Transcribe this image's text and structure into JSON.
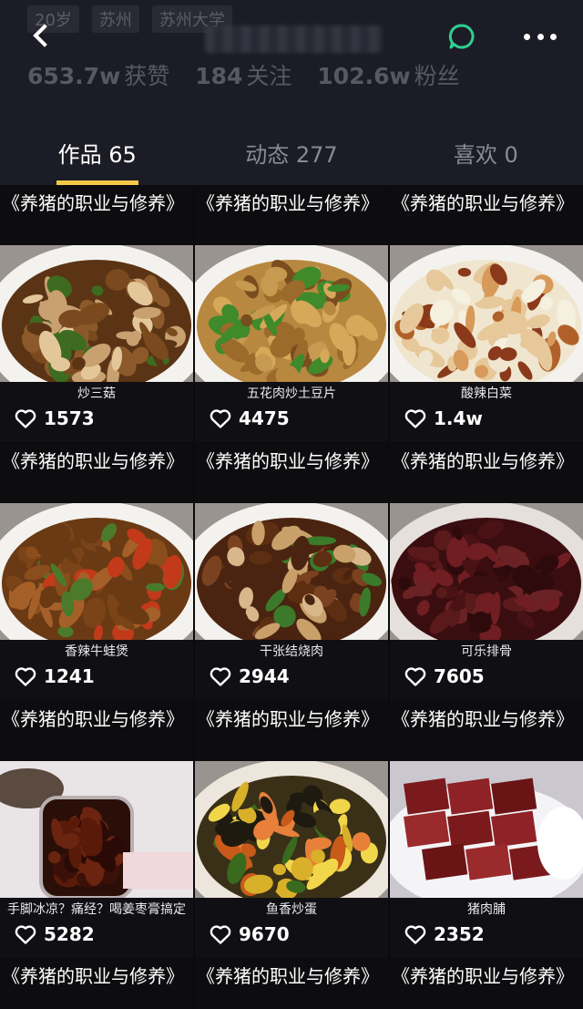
{
  "header": {
    "faded_info": [
      "20岁",
      "苏州",
      "苏州大学"
    ],
    "stats": [
      {
        "value": "653.7w",
        "label": "获赞"
      },
      {
        "value": "184",
        "label": "关注"
      },
      {
        "value": "102.6w",
        "label": "粉丝"
      }
    ]
  },
  "tabs": [
    {
      "label": "作品 65"
    },
    {
      "label": "动态 277"
    },
    {
      "label": "喜欢 0"
    }
  ],
  "accent_color": "#f6c947",
  "videos": [
    {
      "title": "《养猪的职业与修养》",
      "caption": "炒三菇",
      "likes": "1573",
      "dish": "mushroom"
    },
    {
      "title": "《养猪的职业与修养》",
      "caption": "五花肉炒土豆片",
      "likes": "4475",
      "dish": "potato"
    },
    {
      "title": "《养猪的职业与修养》",
      "caption": "酸辣白菜",
      "likes": "1.4w",
      "dish": "cabbage"
    },
    {
      "title": "《养猪的职业与修养》",
      "caption": "香辣牛蛙煲",
      "likes": "1241",
      "dish": "frog"
    },
    {
      "title": "《养猪的职业与修养》",
      "caption": "干张结烧肉",
      "likes": "2944",
      "dish": "pork"
    },
    {
      "title": "《养猪的职业与修养》",
      "caption": "可乐排骨",
      "likes": "7605",
      "dish": "ribs"
    },
    {
      "title": "《养猪的职业与修养》",
      "caption": "手脚冰凉？痛经？喝姜枣膏搞定",
      "likes": "5282",
      "dish": "jar"
    },
    {
      "title": "《养猪的职业与修养》",
      "caption": "鱼香炒蛋",
      "likes": "9670",
      "dish": "egg"
    },
    {
      "title": "《养猪的职业与修养》",
      "caption": "猪肉脯",
      "likes": "2352",
      "dish": "jerky"
    }
  ],
  "partial_row_titles": [
    "《养猪的职业与修养》",
    "《养猪的职业与修养》",
    "《养猪的职业与修养》"
  ]
}
